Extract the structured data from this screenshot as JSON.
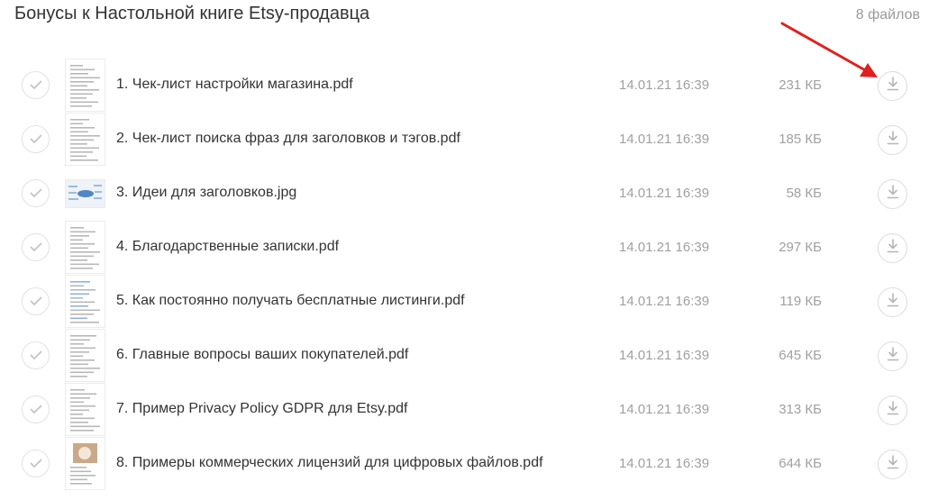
{
  "header": {
    "title": "Бонусы к Настольной книге Etsy-продавца",
    "count": "8 файлов"
  },
  "files": [
    {
      "name": "1. Чек-лист настройки магазина.pdf",
      "date": "14.01.21 16:39",
      "size": "231 КБ",
      "thumb": "pdf"
    },
    {
      "name": "2. Чек-лист поиска фраз для заголовков и тэгов.pdf",
      "date": "14.01.21 16:39",
      "size": "185 КБ",
      "thumb": "pdf"
    },
    {
      "name": "3. Идеи для заголовков.jpg",
      "date": "14.01.21 16:39",
      "size": "58 КБ",
      "thumb": "jpg"
    },
    {
      "name": "4. Благодарственные записки.pdf",
      "date": "14.01.21 16:39",
      "size": "297 КБ",
      "thumb": "pdf"
    },
    {
      "name": "5. Как постоянно получать бесплатные листинги.pdf",
      "date": "14.01.21 16:39",
      "size": "119 КБ",
      "thumb": "pdf"
    },
    {
      "name": "6. Главные вопросы ваших покупателей.pdf",
      "date": "14.01.21 16:39",
      "size": "645 КБ",
      "thumb": "pdf"
    },
    {
      "name": "7. Пример Privacy Policy GDPR для Etsy.pdf",
      "date": "14.01.21 16:39",
      "size": "313 КБ",
      "thumb": "pdf"
    },
    {
      "name": "8. Примеры коммерческих лицензий для цифровых файлов.pdf",
      "date": "14.01.21 16:39",
      "size": "644 КБ",
      "thumb": "pdf"
    }
  ],
  "icons": {
    "check": "check-icon",
    "download": "download-icon",
    "annotation": "red-arrow-icon"
  },
  "colors": {
    "annotation_arrow": "#e02020",
    "muted_text": "#a0a0a0",
    "border": "#dcdcdc"
  }
}
